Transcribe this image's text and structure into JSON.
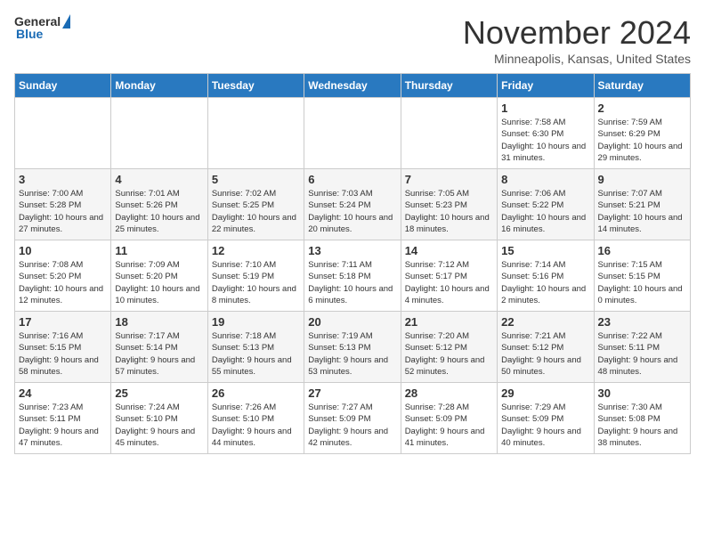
{
  "header": {
    "logo_general": "General",
    "logo_blue": "Blue",
    "month": "November 2024",
    "location": "Minneapolis, Kansas, United States"
  },
  "days_of_week": [
    "Sunday",
    "Monday",
    "Tuesday",
    "Wednesday",
    "Thursday",
    "Friday",
    "Saturday"
  ],
  "weeks": [
    [
      {
        "day": "",
        "sunrise": "",
        "sunset": "",
        "daylight": ""
      },
      {
        "day": "",
        "sunrise": "",
        "sunset": "",
        "daylight": ""
      },
      {
        "day": "",
        "sunrise": "",
        "sunset": "",
        "daylight": ""
      },
      {
        "day": "",
        "sunrise": "",
        "sunset": "",
        "daylight": ""
      },
      {
        "day": "",
        "sunrise": "",
        "sunset": "",
        "daylight": ""
      },
      {
        "day": "1",
        "sunrise": "Sunrise: 7:58 AM",
        "sunset": "Sunset: 6:30 PM",
        "daylight": "Daylight: 10 hours and 31 minutes."
      },
      {
        "day": "2",
        "sunrise": "Sunrise: 7:59 AM",
        "sunset": "Sunset: 6:29 PM",
        "daylight": "Daylight: 10 hours and 29 minutes."
      }
    ],
    [
      {
        "day": "3",
        "sunrise": "Sunrise: 7:00 AM",
        "sunset": "Sunset: 5:28 PM",
        "daylight": "Daylight: 10 hours and 27 minutes."
      },
      {
        "day": "4",
        "sunrise": "Sunrise: 7:01 AM",
        "sunset": "Sunset: 5:26 PM",
        "daylight": "Daylight: 10 hours and 25 minutes."
      },
      {
        "day": "5",
        "sunrise": "Sunrise: 7:02 AM",
        "sunset": "Sunset: 5:25 PM",
        "daylight": "Daylight: 10 hours and 22 minutes."
      },
      {
        "day": "6",
        "sunrise": "Sunrise: 7:03 AM",
        "sunset": "Sunset: 5:24 PM",
        "daylight": "Daylight: 10 hours and 20 minutes."
      },
      {
        "day": "7",
        "sunrise": "Sunrise: 7:05 AM",
        "sunset": "Sunset: 5:23 PM",
        "daylight": "Daylight: 10 hours and 18 minutes."
      },
      {
        "day": "8",
        "sunrise": "Sunrise: 7:06 AM",
        "sunset": "Sunset: 5:22 PM",
        "daylight": "Daylight: 10 hours and 16 minutes."
      },
      {
        "day": "9",
        "sunrise": "Sunrise: 7:07 AM",
        "sunset": "Sunset: 5:21 PM",
        "daylight": "Daylight: 10 hours and 14 minutes."
      }
    ],
    [
      {
        "day": "10",
        "sunrise": "Sunrise: 7:08 AM",
        "sunset": "Sunset: 5:20 PM",
        "daylight": "Daylight: 10 hours and 12 minutes."
      },
      {
        "day": "11",
        "sunrise": "Sunrise: 7:09 AM",
        "sunset": "Sunset: 5:20 PM",
        "daylight": "Daylight: 10 hours and 10 minutes."
      },
      {
        "day": "12",
        "sunrise": "Sunrise: 7:10 AM",
        "sunset": "Sunset: 5:19 PM",
        "daylight": "Daylight: 10 hours and 8 minutes."
      },
      {
        "day": "13",
        "sunrise": "Sunrise: 7:11 AM",
        "sunset": "Sunset: 5:18 PM",
        "daylight": "Daylight: 10 hours and 6 minutes."
      },
      {
        "day": "14",
        "sunrise": "Sunrise: 7:12 AM",
        "sunset": "Sunset: 5:17 PM",
        "daylight": "Daylight: 10 hours and 4 minutes."
      },
      {
        "day": "15",
        "sunrise": "Sunrise: 7:14 AM",
        "sunset": "Sunset: 5:16 PM",
        "daylight": "Daylight: 10 hours and 2 minutes."
      },
      {
        "day": "16",
        "sunrise": "Sunrise: 7:15 AM",
        "sunset": "Sunset: 5:15 PM",
        "daylight": "Daylight: 10 hours and 0 minutes."
      }
    ],
    [
      {
        "day": "17",
        "sunrise": "Sunrise: 7:16 AM",
        "sunset": "Sunset: 5:15 PM",
        "daylight": "Daylight: 9 hours and 58 minutes."
      },
      {
        "day": "18",
        "sunrise": "Sunrise: 7:17 AM",
        "sunset": "Sunset: 5:14 PM",
        "daylight": "Daylight: 9 hours and 57 minutes."
      },
      {
        "day": "19",
        "sunrise": "Sunrise: 7:18 AM",
        "sunset": "Sunset: 5:13 PM",
        "daylight": "Daylight: 9 hours and 55 minutes."
      },
      {
        "day": "20",
        "sunrise": "Sunrise: 7:19 AM",
        "sunset": "Sunset: 5:13 PM",
        "daylight": "Daylight: 9 hours and 53 minutes."
      },
      {
        "day": "21",
        "sunrise": "Sunrise: 7:20 AM",
        "sunset": "Sunset: 5:12 PM",
        "daylight": "Daylight: 9 hours and 52 minutes."
      },
      {
        "day": "22",
        "sunrise": "Sunrise: 7:21 AM",
        "sunset": "Sunset: 5:12 PM",
        "daylight": "Daylight: 9 hours and 50 minutes."
      },
      {
        "day": "23",
        "sunrise": "Sunrise: 7:22 AM",
        "sunset": "Sunset: 5:11 PM",
        "daylight": "Daylight: 9 hours and 48 minutes."
      }
    ],
    [
      {
        "day": "24",
        "sunrise": "Sunrise: 7:23 AM",
        "sunset": "Sunset: 5:11 PM",
        "daylight": "Daylight: 9 hours and 47 minutes."
      },
      {
        "day": "25",
        "sunrise": "Sunrise: 7:24 AM",
        "sunset": "Sunset: 5:10 PM",
        "daylight": "Daylight: 9 hours and 45 minutes."
      },
      {
        "day": "26",
        "sunrise": "Sunrise: 7:26 AM",
        "sunset": "Sunset: 5:10 PM",
        "daylight": "Daylight: 9 hours and 44 minutes."
      },
      {
        "day": "27",
        "sunrise": "Sunrise: 7:27 AM",
        "sunset": "Sunset: 5:09 PM",
        "daylight": "Daylight: 9 hours and 42 minutes."
      },
      {
        "day": "28",
        "sunrise": "Sunrise: 7:28 AM",
        "sunset": "Sunset: 5:09 PM",
        "daylight": "Daylight: 9 hours and 41 minutes."
      },
      {
        "day": "29",
        "sunrise": "Sunrise: 7:29 AM",
        "sunset": "Sunset: 5:09 PM",
        "daylight": "Daylight: 9 hours and 40 minutes."
      },
      {
        "day": "30",
        "sunrise": "Sunrise: 7:30 AM",
        "sunset": "Sunset: 5:08 PM",
        "daylight": "Daylight: 9 hours and 38 minutes."
      }
    ]
  ]
}
